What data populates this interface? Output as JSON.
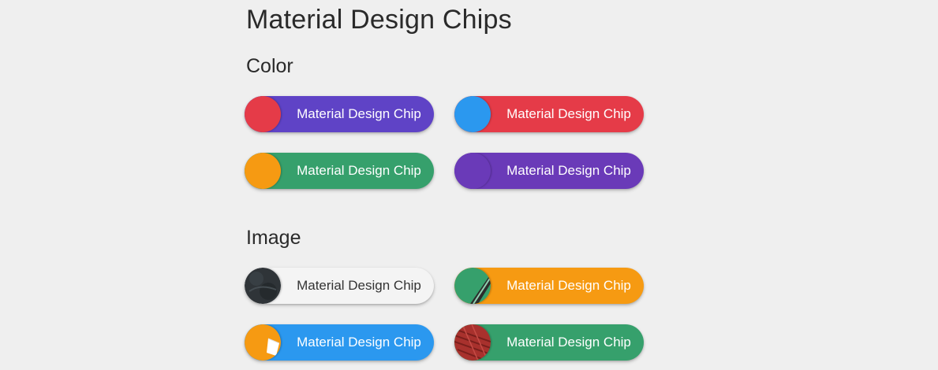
{
  "page": {
    "title": "Material Design Chips"
  },
  "sections": {
    "color": {
      "title": "Color",
      "chips": [
        {
          "label": "Material Design Chip",
          "avatar_color": "#e53b48",
          "chip_color": "#5f43c6"
        },
        {
          "label": "Material Design Chip",
          "avatar_color": "#2b98ef",
          "chip_color": "#e53b48"
        },
        {
          "label": "Material Design Chip",
          "avatar_color": "#f69a12",
          "chip_color": "#36a06c"
        },
        {
          "label": "Material Design Chip",
          "avatar_color": "#6a3ab8",
          "chip_color": "#6a3ab8"
        }
      ]
    },
    "image": {
      "title": "Image",
      "chips": [
        {
          "label": "Material Design Chip",
          "avatar": "dark-texture-image",
          "chip_color": "#f4f4f4"
        },
        {
          "label": "Material Design Chip",
          "avatar": "green-stripe-image",
          "chip_color": "#f69a12"
        },
        {
          "label": "Material Design Chip",
          "avatar": "orange-white-image",
          "chip_color": "#2b98ef"
        },
        {
          "label": "Material Design Chip",
          "avatar": "red-texture-image",
          "chip_color": "#36a06c"
        }
      ]
    }
  }
}
